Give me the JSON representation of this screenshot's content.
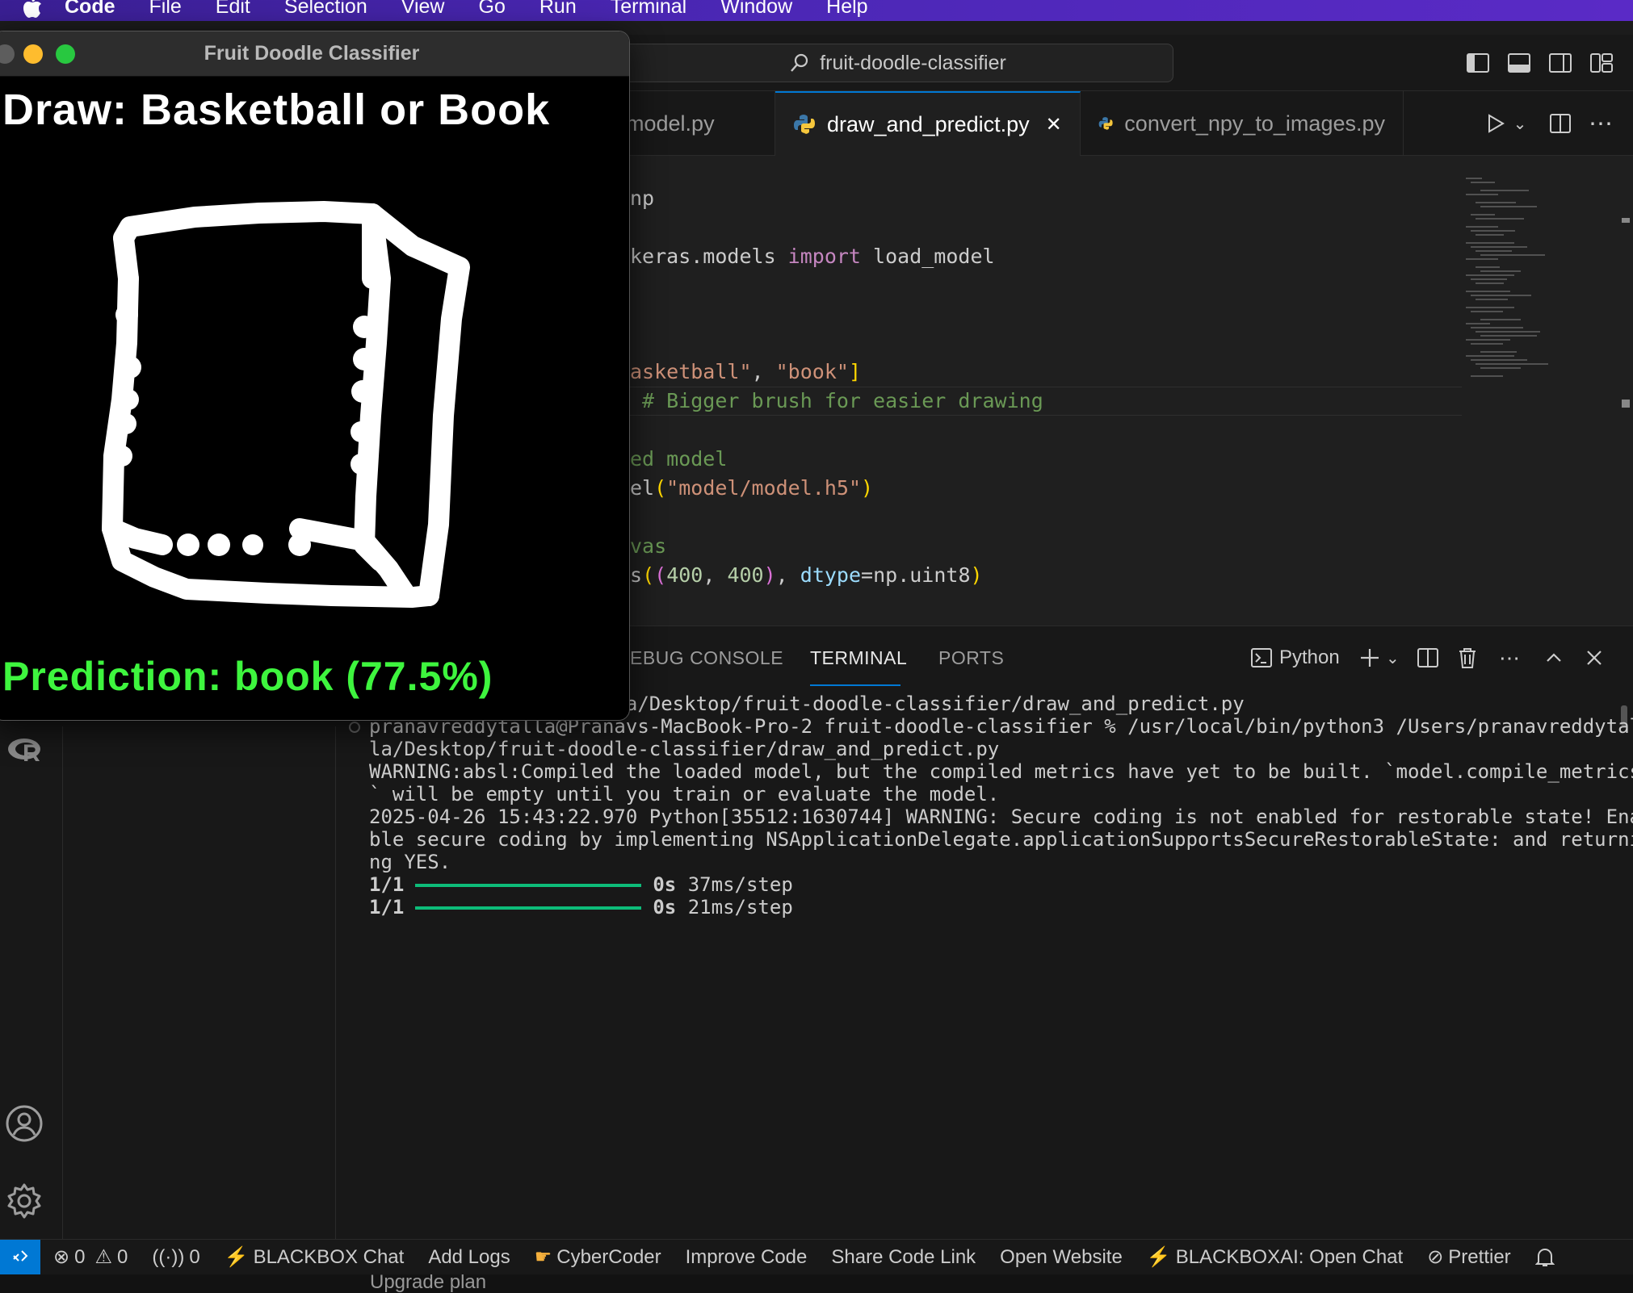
{
  "menubar": {
    "app": "Code",
    "items": [
      "File",
      "Edit",
      "Selection",
      "View",
      "Go",
      "Run",
      "Terminal",
      "Window",
      "Help"
    ]
  },
  "vscode": {
    "search": "fruit-doodle-classifier",
    "tabs": [
      {
        "label": "_model.py"
      },
      {
        "label": "draw_and_predict.py",
        "close": "✕"
      },
      {
        "label": "convert_npy_to_images.py"
      }
    ],
    "editor": {
      "lines": [
        {
          "id": "l1",
          "parts": [
            {
              "t": "np",
              "c": ""
            }
          ]
        },
        {
          "id": "l2",
          "parts": [
            {
              "t": "keras.models ",
              "c": ""
            },
            {
              "t": "import",
              "c": "kw"
            },
            {
              "t": " load_model",
              "c": ""
            }
          ]
        },
        {
          "id": "l3",
          "parts": [
            {
              "t": "asketball\"",
              "c": "str"
            },
            {
              "t": ", ",
              "c": ""
            },
            {
              "t": "\"book\"",
              "c": "str"
            },
            {
              "t": "]",
              "c": "br"
            }
          ]
        },
        {
          "id": "l4",
          "parts": [
            {
              "t": " # Bigger brush for easier drawing",
              "c": "cm"
            }
          ]
        },
        {
          "id": "l5",
          "parts": [
            {
              "t": "ed model",
              "c": "cm"
            }
          ]
        },
        {
          "id": "l6",
          "parts": [
            {
              "t": "el",
              "c": ""
            },
            {
              "t": "(",
              "c": "br"
            },
            {
              "t": "\"model/model.h5\"",
              "c": "str"
            },
            {
              "t": ")",
              "c": "br"
            }
          ]
        },
        {
          "id": "l7",
          "parts": [
            {
              "t": "vas",
              "c": "cm"
            }
          ]
        },
        {
          "id": "l8",
          "parts": [
            {
              "t": "s",
              "c": ""
            },
            {
              "t": "(",
              "c": "br"
            },
            {
              "t": "(",
              "c": "br2"
            },
            {
              "t": "400",
              "c": "num"
            },
            {
              "t": ", ",
              "c": ""
            },
            {
              "t": "400",
              "c": "num"
            },
            {
              "t": ")",
              "c": "br2"
            },
            {
              "t": ", ",
              "c": ""
            },
            {
              "t": "dtype",
              "c": "param"
            },
            {
              "t": "=np.uint8",
              "c": ""
            },
            {
              "t": ")",
              "c": "br"
            }
          ]
        }
      ]
    },
    "panel": {
      "tabs": [
        "EBUG CONSOLE",
        "TERMINAL",
        "PORTS"
      ],
      "terminal_profile": "Python",
      "lines": [
        "/Users/pranavreddytalla/Desktop/fruit-doodle-classifier/draw_and_predict.py",
        "pranavreddytalla@Pranavs-MacBook-Pro-2 fruit-doodle-classifier % /usr/local/bin/python3 /Users/pranavreddytal",
        "la/Desktop/fruit-doodle-classifier/draw_and_predict.py",
        "WARNING:absl:Compiled the loaded model, but the compiled metrics have yet to be built. `model.compile_metrics",
        "` will be empty until you train or evaluate the model.",
        "2025-04-26 15:43:22.970 Python[35512:1630744] WARNING: Secure coding is not enabled for restorable state! Ena",
        "ble secure coding by implementing NSApplicationDelegate.applicationSupportsSecureRestorableState: and returni",
        "ng YES."
      ],
      "progress": [
        {
          "step": "1/1",
          "time": "0s",
          "rate": "37ms/step"
        },
        {
          "step": "1/1",
          "time": "0s",
          "rate": "21ms/step"
        }
      ]
    },
    "statusbar": {
      "errors": "0",
      "warnings": "0",
      "ports": "0",
      "items": [
        "BLACKBOX Chat",
        "Add Logs",
        "CyberCoder",
        "Improve Code",
        "Share Code Link",
        "Open Website",
        "BLACKBOXAI: Open Chat",
        "Prettier"
      ],
      "below": "Upgrade plan"
    }
  },
  "cv_window": {
    "title": "Fruit Doodle Classifier",
    "prompt": "Draw: Basketball or Book",
    "prediction": "Prediction: book (77.5%)",
    "colors": {
      "prediction": "#3ef53e",
      "ink": "#ffffff"
    }
  }
}
